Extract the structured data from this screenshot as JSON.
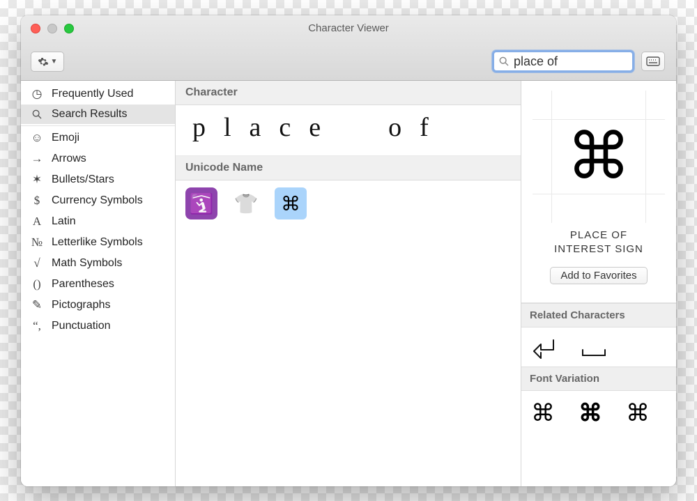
{
  "window": {
    "title": "Character Viewer"
  },
  "search": {
    "value": "place of"
  },
  "sidebar": {
    "top": [
      {
        "icon": "clock",
        "label": "Frequently Used"
      },
      {
        "icon": "search",
        "label": "Search Results",
        "selected": true
      }
    ],
    "categories": [
      {
        "icon": "emoji",
        "label": "Emoji"
      },
      {
        "icon": "arrow",
        "label": "Arrows"
      },
      {
        "icon": "star",
        "label": "Bullets/Stars"
      },
      {
        "icon": "dollar",
        "label": "Currency Symbols"
      },
      {
        "icon": "latin",
        "label": "Latin"
      },
      {
        "icon": "numero",
        "label": "Letterlike Symbols"
      },
      {
        "icon": "radical",
        "label": "Math Symbols"
      },
      {
        "icon": "paren",
        "label": "Parentheses"
      },
      {
        "icon": "picto",
        "label": "Pictographs"
      },
      {
        "icon": "comma",
        "label": "Punctuation"
      }
    ]
  },
  "mid": {
    "character_header": "Character",
    "character_display": "place  of",
    "unicode_header": "Unicode Name",
    "results": [
      {
        "glyph": "🛐",
        "selected": false
      },
      {
        "glyph": "👕",
        "selected": false
      },
      {
        "glyph": "⌘",
        "selected": true
      }
    ]
  },
  "detail": {
    "glyph": "⌘",
    "name_line1": "PLACE OF",
    "name_line2": "INTEREST SIGN",
    "favorites_label": "Add to Favorites",
    "related_header": "Related Characters",
    "related": [
      "⏎",
      "␣"
    ],
    "fontvar_header": "Font Variation",
    "fontvars": [
      "⌘",
      "⌘",
      "⌘"
    ]
  }
}
